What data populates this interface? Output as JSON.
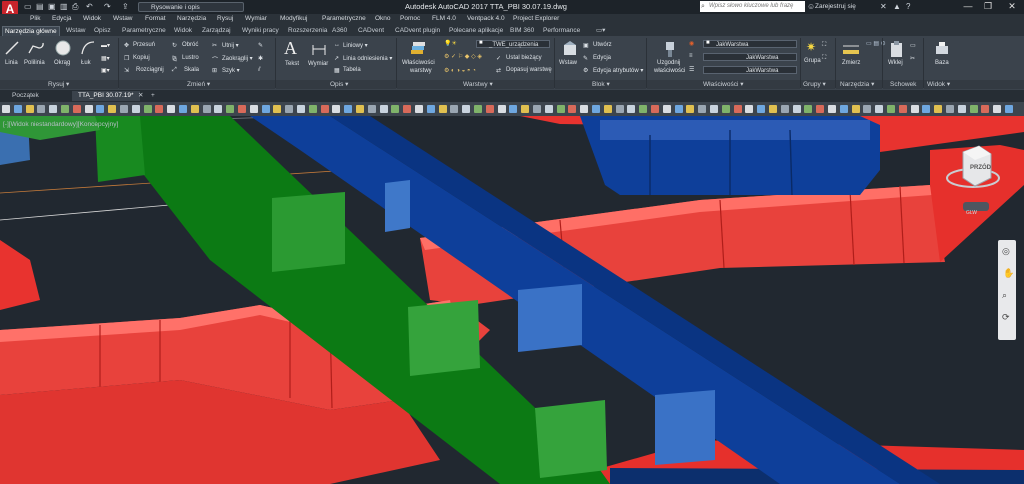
{
  "titlebar": {
    "app_icon": "A",
    "workspace": "Rysowanie i opis",
    "title": "Autodesk AutoCAD 2017   TTA_PBI 30.07.19.dwg",
    "search_placeholder": "Wpisz słowo kluczowe lub frazę",
    "signin": "Zarejestruj się",
    "buttons": [
      "—",
      "❐",
      "✕"
    ]
  },
  "menubar": [
    "Plik",
    "Edycja",
    "Widok",
    "Wstaw",
    "Format",
    "Narzędzia",
    "Rysuj",
    "Wymiar",
    "Modyfikuj",
    "Parametryczne",
    "Okno",
    "Pomoc",
    "FLM 4.0",
    "Ventpack 4.0",
    "Project Explorer"
  ],
  "ribbon_tabs": [
    "Narzędzia główne",
    "Wstaw",
    "Opisz",
    "Parametryczne",
    "Widok",
    "Zarządzaj",
    "Wyniki pracy",
    "Rozszerzenia",
    "A360",
    "CADvent",
    "CADvent plugin",
    "Polecane aplikacje",
    "BIM 360",
    "Performance"
  ],
  "ribbon": {
    "draw": {
      "linia": "Linia",
      "polilinia": "Polilinia",
      "okrag": "Okrąg",
      "luk": "Łuk",
      "title": "Rysuj ▾"
    },
    "modify": {
      "przesun": "Przesuń",
      "obroc": "Obróć",
      "utnij": "Utnij ▾",
      "kopiuj": "Kopiuj",
      "lustro": "Lustro",
      "zaokraglij": "Zaokrąglij ▾",
      "rozciagnij": "Rozciągnij",
      "skala": "Skala",
      "szyk": "Szyk ▾",
      "title": "Zmień ▾"
    },
    "annotation": {
      "tekst": "Tekst",
      "wymiar": "Wymiar",
      "liniowy": "Liniowy ▾",
      "linia_odniesienia": "Linia odniesienia ▾",
      "tabela": "Tabela",
      "title": "Opis ▾"
    },
    "layers": {
      "wlasciwosci": "Właściwości",
      "warstwy": "warstwy",
      "layer_combo": "_TWE_urządzenia",
      "ustal": "Ustal bieżący",
      "dopasuj": "Dopasuj warstwę",
      "title": "Warstwy ▾"
    },
    "block": {
      "wstaw": "Wstaw",
      "utworz": "Utwórz",
      "edycja": "Edycja",
      "edycja_atr": "Edycja atrybutów ▾",
      "title": "Blok ▾"
    },
    "properties": {
      "uzgodnij": "Uzgodnij",
      "wlasciwosci": "właściwości",
      "jak1": "JakWarstwa",
      "jak2": "JakWarstwa",
      "jak3": "JakWarstwa",
      "title": "Właściwości ▾"
    },
    "groups": {
      "grupa": "Grupa",
      "title": "Grupy ▾"
    },
    "utilities": {
      "zmierz": "Zmierz",
      "title": "Narzędzia ▾"
    },
    "clipboard": {
      "wklej": "Wklej",
      "title": "Schowek"
    },
    "view": {
      "baza": "Baza",
      "title": "Widok ▾"
    }
  },
  "file_tabs": {
    "start": "Początek",
    "active": "TTA_PBI 30.07.19*",
    "add": "+"
  },
  "viewport": {
    "label": "[-][Widok niestandardowy][Koncepcyjny]",
    "viewcube_face": "PRZÓD",
    "ucs_label": "GLW"
  },
  "colors": {
    "red_duct": "#e8332f",
    "green_duct": "#0c7a14",
    "blue_duct": "#0e3f9a",
    "background": "#212830"
  }
}
